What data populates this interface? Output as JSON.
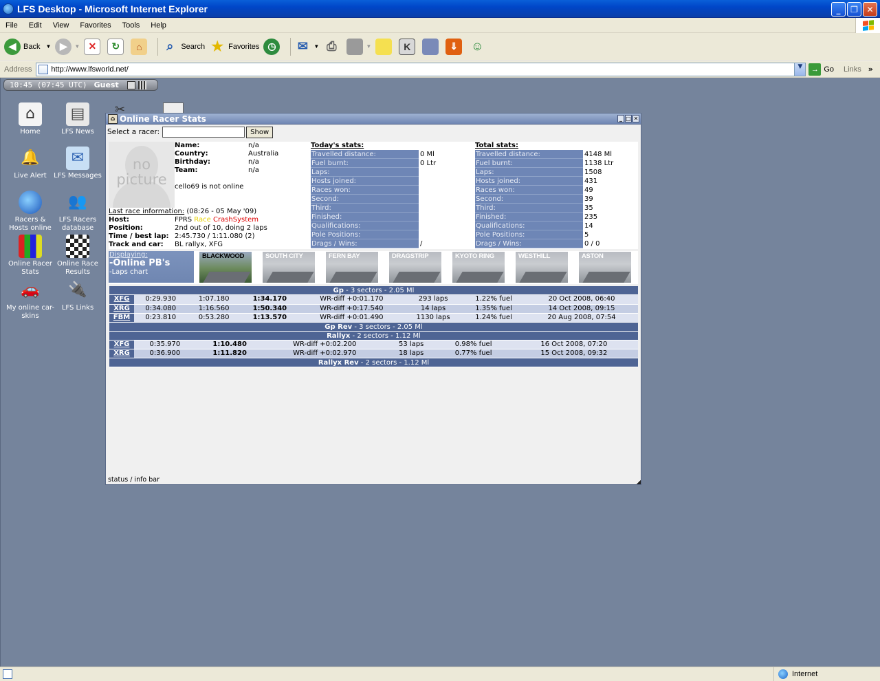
{
  "window": {
    "title": "LFS Desktop - Microsoft Internet Explorer"
  },
  "menu": [
    "File",
    "Edit",
    "View",
    "Favorites",
    "Tools",
    "Help"
  ],
  "toolbar": {
    "back": "Back",
    "search": "Search",
    "favorites": "Favorites"
  },
  "address": {
    "label": "Address",
    "url": "http://www.lfsworld.net/",
    "go": "Go",
    "links": "Links"
  },
  "lfsbar": {
    "time": "10:45 (07:45 UTC)",
    "user": "Guest"
  },
  "desktop_icons": [
    {
      "label": "Home",
      "icon": "home-icon"
    },
    {
      "label": "LFS News",
      "icon": "newspaper-icon"
    },
    {
      "label": "Live Alert",
      "icon": "alert-icon"
    },
    {
      "label": "LFS Messages",
      "icon": "envelope-icon"
    },
    {
      "label": "Racers & Hosts online",
      "icon": "globe-icon"
    },
    {
      "label": "LFS Racers database",
      "icon": "racers-icon"
    },
    {
      "label": "Online Racer Stats",
      "icon": "stats-icon"
    },
    {
      "label": "Online Race Results",
      "icon": "flag-icon"
    },
    {
      "label": "My online car-skins",
      "icon": "car-icon"
    },
    {
      "label": "LFS Links",
      "icon": "plug-icon"
    }
  ],
  "panel": {
    "title": "Online Racer Stats",
    "select_label": "Select a racer:",
    "select_value": "",
    "show_button": "Show",
    "nopicture": "no picture",
    "profile": [
      {
        "k": "Name:",
        "v": "n/a"
      },
      {
        "k": "Country:",
        "v": "Australia"
      },
      {
        "k": "Birthday:",
        "v": "n/a"
      },
      {
        "k": "Team:",
        "v": "n/a"
      }
    ],
    "online_status": "cello69 is not online",
    "last_race": {
      "label": "Last race information:",
      "when": "(08:26 - 05 May '09)",
      "host_k": "Host:",
      "host_a": "FPRS",
      "host_b": "Race",
      "host_c": "CrashSystem",
      "position_k": "Position:",
      "position_v": "2nd out of 10, doing 2 laps",
      "time_k": "Time / best lap:",
      "time_v": "2:45.730 / 1:11.080 (2)",
      "track_k": "Track and car:",
      "track_v": "BL rallyx, XFG"
    },
    "today": {
      "header": "Today's stats:",
      "rows": [
        {
          "k": "Travelled distance:",
          "v": "0 Ml"
        },
        {
          "k": "Fuel burnt:",
          "v": "0 Ltr"
        },
        {
          "k": "Laps:",
          "v": ""
        },
        {
          "k": "Hosts joined:",
          "v": ""
        },
        {
          "k": "Races won:",
          "v": ""
        },
        {
          "k": "Second:",
          "v": ""
        },
        {
          "k": "Third:",
          "v": ""
        },
        {
          "k": "Finished:",
          "v": ""
        },
        {
          "k": "Qualifications:",
          "v": ""
        },
        {
          "k": "Pole Positions:",
          "v": ""
        },
        {
          "k": "Drags / Wins:",
          "v": "/"
        }
      ]
    },
    "total": {
      "header": "Total stats:",
      "rows": [
        {
          "k": "Travelled distance:",
          "v": "4148 Ml"
        },
        {
          "k": "Fuel burnt:",
          "v": "1138 Ltr"
        },
        {
          "k": "Laps:",
          "v": "1508"
        },
        {
          "k": "Hosts joined:",
          "v": "431"
        },
        {
          "k": "Races won:",
          "v": "49"
        },
        {
          "k": "Second:",
          "v": "39"
        },
        {
          "k": "Third:",
          "v": "35"
        },
        {
          "k": "Finished:",
          "v": "235"
        },
        {
          "k": "Qualifications:",
          "v": "14"
        },
        {
          "k": "Pole Positions:",
          "v": "5"
        },
        {
          "k": "Drags / Wins:",
          "v": "0 / 0"
        }
      ]
    },
    "displaying": {
      "label": "Displaying:",
      "current": "-Online PB's",
      "alt": "-Laps chart"
    },
    "tracks": [
      "BLACKWOOD",
      "SOUTH CITY",
      "FERN BAY",
      "DRAGSTRIP",
      "KYOTO RING",
      "WESTHILL",
      "ASTON"
    ],
    "sections": [
      {
        "name": "Gp",
        "info": " - 3 sectors - 2.05 Ml",
        "rows": [
          {
            "car": "XFG",
            "s1": "0:29.930",
            "s2": "1:07.180",
            "best": "1:34.170",
            "wr": "WR-diff +0:01.170",
            "laps": "293 laps",
            "fuel": "1.22% fuel",
            "date": "20 Oct 2008, 06:40"
          },
          {
            "car": "XRG",
            "s1": "0:34.080",
            "s2": "1:16.560",
            "best": "1:50.340",
            "wr": "WR-diff +0:17.540",
            "laps": "14 laps",
            "fuel": "1.35% fuel",
            "date": "14 Oct 2008, 09:15"
          },
          {
            "car": "FBM",
            "s1": "0:23.810",
            "s2": "0:53.280",
            "best": "1:13.570",
            "wr": "WR-diff +0:01.490",
            "laps": "1130 laps",
            "fuel": "1.24% fuel",
            "date": "20 Aug 2008, 07:54"
          }
        ]
      },
      {
        "name": "Gp Rev",
        "info": " - 3 sectors - 2.05 Ml",
        "rows": []
      },
      {
        "name": "Rallyx",
        "info": " - 2 sectors - 1.12 Ml",
        "rows": [
          {
            "car": "XFG",
            "s1": "0:35.970",
            "best": "1:10.480",
            "wr": "WR-diff +0:02.200",
            "laps": "53 laps",
            "fuel": "0.98% fuel",
            "date": "16 Oct 2008, 07:20"
          },
          {
            "car": "XRG",
            "s1": "0:36.900",
            "best": "1:11.820",
            "wr": "WR-diff +0:02.970",
            "laps": "18 laps",
            "fuel": "0.77% fuel",
            "date": "15 Oct 2008, 09:32"
          }
        ]
      },
      {
        "name": "Rallyx Rev",
        "info": " - 2 sectors - 1.12 Ml",
        "rows": []
      }
    ],
    "status": "status / info bar"
  },
  "statusbar": {
    "zone": "Internet"
  }
}
